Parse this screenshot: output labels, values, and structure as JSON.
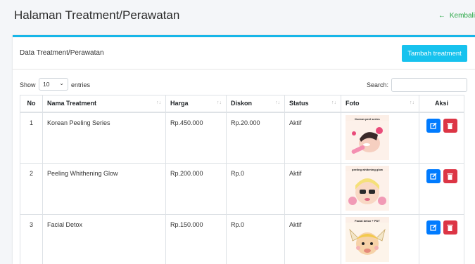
{
  "header": {
    "title": "Halaman Treatment/Perawatan",
    "back_label": "Kembali"
  },
  "card": {
    "title": "Data Treatment/Perawatan",
    "add_button": "Tambah treatment"
  },
  "controls": {
    "show_label": "Show",
    "length_value": "10",
    "entries_label": "entries",
    "search_label": "Search:",
    "search_value": ""
  },
  "table": {
    "columns": [
      "No",
      "Nama Treatment",
      "Harga",
      "Diskon",
      "Status",
      "Foto",
      "Aksi"
    ],
    "rows": [
      {
        "no": "1",
        "nama": "Korean Peeling Series",
        "harga": "Rp.450.000",
        "diskon": "Rp.20.000",
        "status": "Aktif",
        "foto_caption": "Korean peel series"
      },
      {
        "no": "2",
        "nama": "Peeling Whithening Glow",
        "harga": "Rp.200.000",
        "diskon": "Rp.0",
        "status": "Aktif",
        "foto_caption": "peeling whitening glow"
      },
      {
        "no": "3",
        "nama": "Facial Detox",
        "harga": "Rp.150.000",
        "diskon": "Rp.0",
        "status": "Aktif",
        "foto_caption": "Facial detox + PDT"
      }
    ]
  },
  "colors": {
    "accent": "#17c2ee",
    "edit": "#007bff",
    "delete": "#dc3545",
    "back_link": "#28a745"
  },
  "icons": {
    "back": "arrow-left-icon",
    "edit": "edit-icon",
    "delete": "trash-icon",
    "select": "chevron-down-icon",
    "sort": "sort-icon"
  }
}
